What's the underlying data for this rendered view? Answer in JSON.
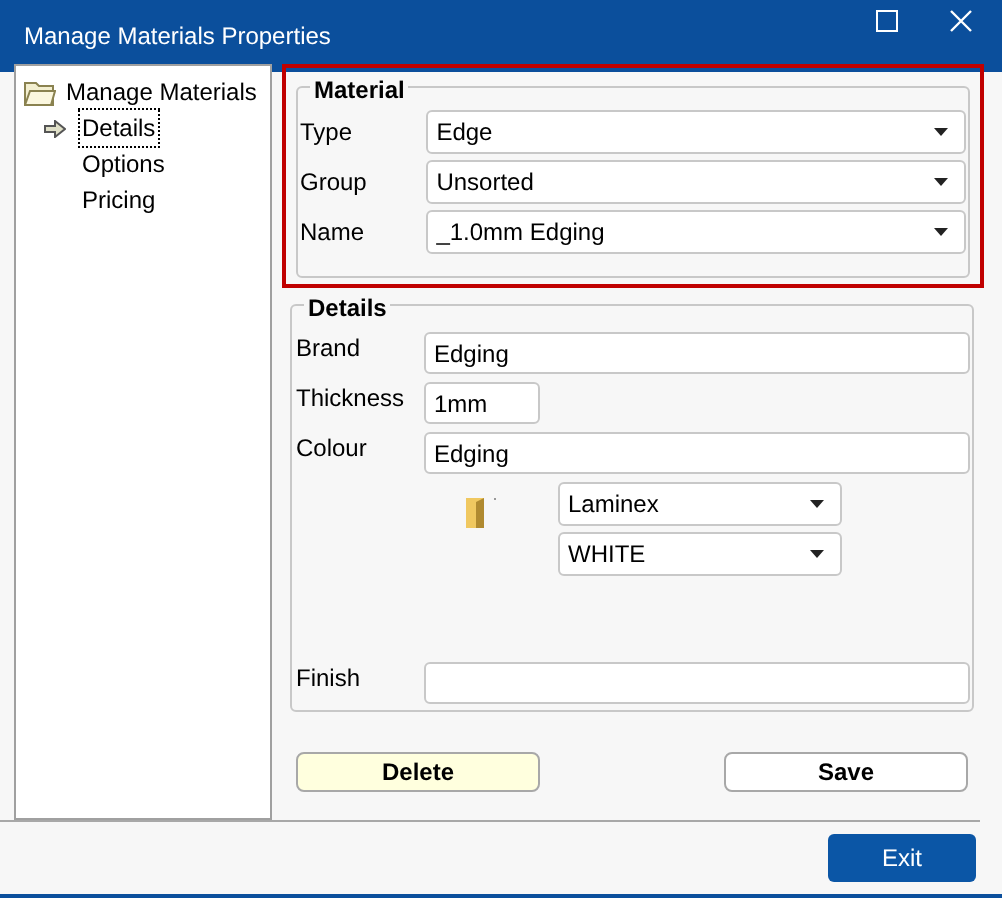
{
  "window": {
    "title": "Manage Materials Properties"
  },
  "tree": {
    "label": "Manage Materials",
    "children": [
      {
        "label": "Details",
        "selected": true
      },
      {
        "label": "Options",
        "selected": false
      },
      {
        "label": "Pricing",
        "selected": false
      }
    ]
  },
  "material": {
    "title": "Material",
    "fields": [
      {
        "label": "Type",
        "value": "Edge"
      },
      {
        "label": "Group",
        "value": "Unsorted"
      },
      {
        "label": "Name",
        "value": "_1.0mm Edging"
      }
    ]
  },
  "details": {
    "title": "Details",
    "fields": [
      {
        "kind": "text",
        "label": "Brand",
        "value": "Edging"
      },
      {
        "kind": "short_text",
        "label": "Thickness",
        "value": "1mm"
      },
      {
        "kind": "text",
        "label": "Colour",
        "value": "Edging"
      },
      {
        "kind": "picker",
        "dropdowns": [
          "Laminex",
          "WHITE"
        ]
      },
      {
        "kind": "text",
        "label": "Finish"
      }
    ]
  },
  "buttons": [
    {
      "kind": "delete",
      "label": "Delete"
    },
    {
      "kind": "save",
      "label": "Save"
    }
  ],
  "exit_button": "Exit"
}
